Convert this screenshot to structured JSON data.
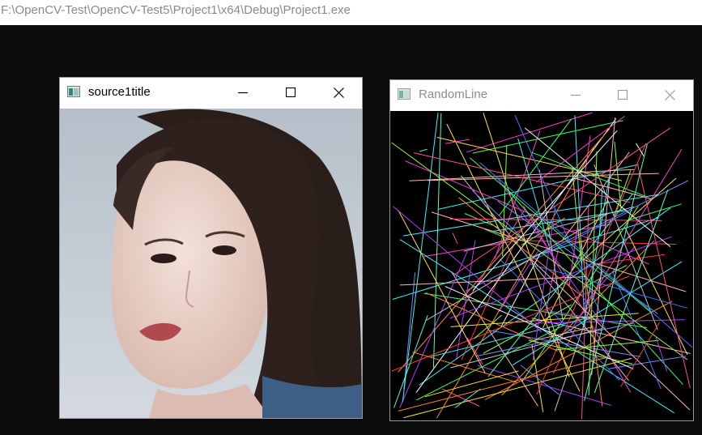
{
  "console": {
    "title": "F:\\OpenCV-Test\\OpenCV-Test5\\Project1\\x64\\Debug\\Project1.exe"
  },
  "windows": [
    {
      "title": "source1title",
      "active": true,
      "content": "portrait photo"
    },
    {
      "title": "RandomLine",
      "active": false,
      "content": "random colored lines"
    }
  ],
  "colors": {
    "console_bg": "#0c0c0c",
    "titlebar_bg": "#ffffff",
    "inactive_title": "#8c8c8c",
    "canvas_bg": "#000000"
  },
  "controls": {
    "minimize": "minimize-icon",
    "maximize": "maximize-icon",
    "close": "close-icon"
  }
}
